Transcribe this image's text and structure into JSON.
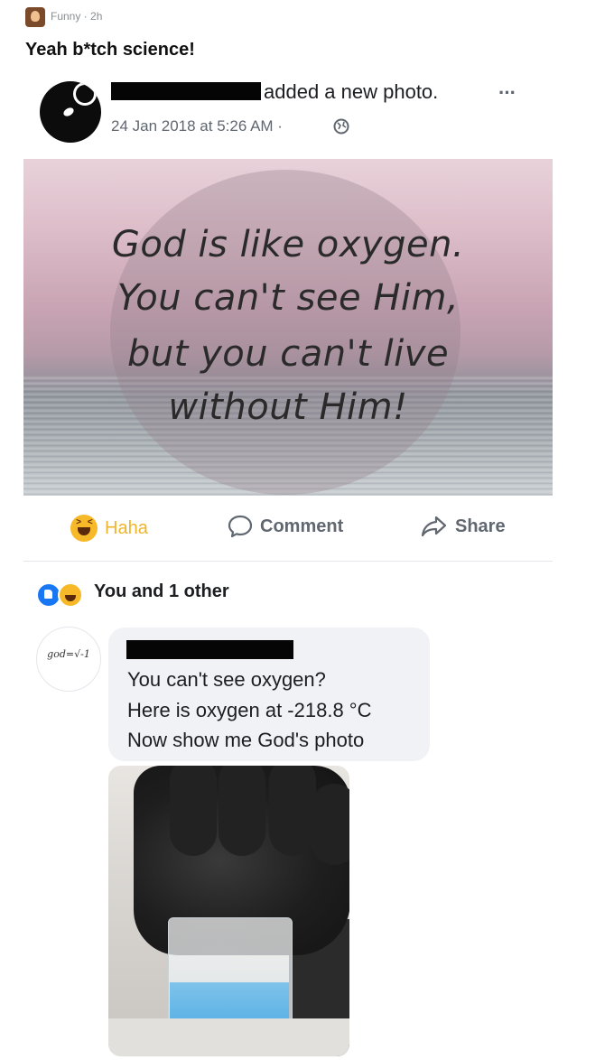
{
  "repost": {
    "meta": "Funny · 2h",
    "title": "Yeah b*tch science!"
  },
  "post": {
    "action_text": "added a new photo.",
    "more_label": "···",
    "date": "24 Jan 2018 at 5:26 AM ·",
    "photo_quote": [
      "God is like oxygen.",
      "You can't see Him,",
      "but you can't live",
      "without Him!"
    ]
  },
  "actions": {
    "haha": "Haha",
    "comment": "Comment",
    "share": "Share"
  },
  "reactions": {
    "summary": "You and 1 other"
  },
  "comment": {
    "avatar_text": "god=√-1",
    "lines": [
      "You can't see oxygen?",
      "Here is oxygen at -218.8 °C",
      "Now show me God's photo"
    ]
  },
  "colors": {
    "fb_blue": "#1877f2",
    "haha_yellow": "#f7b928",
    "meta_gray": "#606770",
    "bubble_bg": "#f0f2f5",
    "liquid_oxygen_blue": "#5fb4e6"
  },
  "icons": [
    "subreddit-avatar-icon",
    "more-icon",
    "globe-icon",
    "haha-icon",
    "comment-icon",
    "share-icon",
    "like-icon"
  ]
}
